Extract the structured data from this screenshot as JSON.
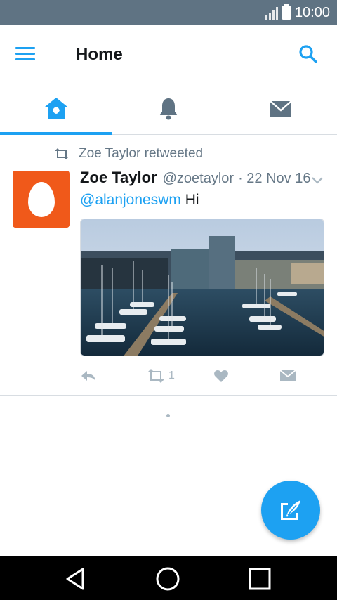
{
  "status_bar": {
    "time": "10:00"
  },
  "app_bar": {
    "title": "Home"
  },
  "tabs": [
    {
      "name": "home",
      "icon": "home-icon",
      "active": true
    },
    {
      "name": "notifications",
      "icon": "bell-icon",
      "active": false
    },
    {
      "name": "messages",
      "icon": "envelope-icon",
      "active": false
    }
  ],
  "tweet": {
    "retweet_context": "Zoe Taylor retweeted",
    "display_name": "Zoe Taylor",
    "handle": "@zoetaylor",
    "date": "· 22 Nov 16",
    "mention": "@alanjoneswm",
    "text": " Hi",
    "media_description": "harbor-photo",
    "retweet_count": "1"
  },
  "colors": {
    "accent": "#1da1f2",
    "status_bar": "#5f7383",
    "avatar_bg": "#f0591a",
    "muted": "#657786",
    "action_icon": "#aab8c2"
  }
}
